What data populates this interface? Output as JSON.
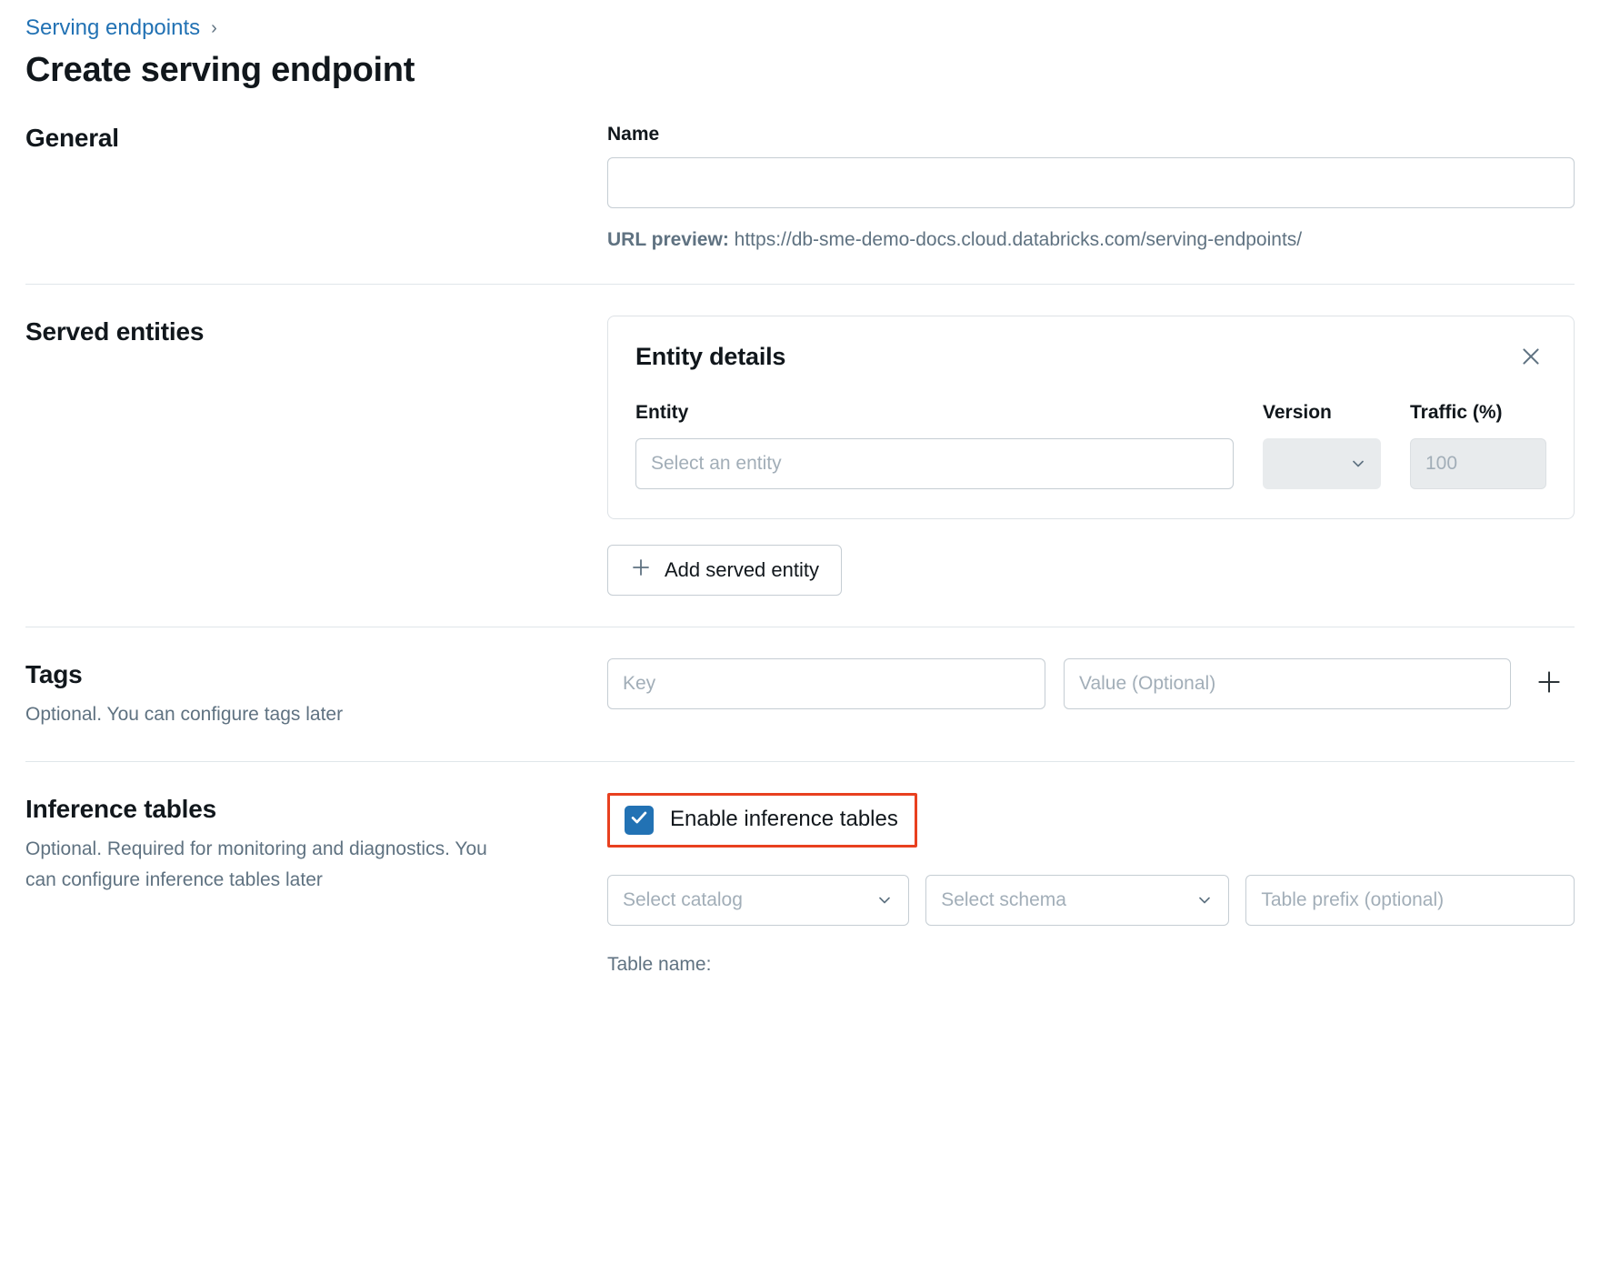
{
  "breadcrumb": {
    "link_label": "Serving endpoints",
    "separator": "›"
  },
  "page_title": "Create serving endpoint",
  "general": {
    "heading": "General",
    "name_label": "Name",
    "name_value": "",
    "name_placeholder": "",
    "url_preview_label": "URL preview:",
    "url_preview_value": "https://db-sme-demo-docs.cloud.databricks.com/serving-endpoints/"
  },
  "served_entities": {
    "heading": "Served entities",
    "card": {
      "title": "Entity details",
      "close_icon": "close-icon",
      "columns": {
        "entity": "Entity",
        "version": "Version",
        "traffic": "Traffic (%)"
      },
      "entity_placeholder": "Select an entity",
      "version_value": "",
      "version_disabled": true,
      "traffic_value": "100",
      "traffic_disabled": true
    },
    "add_button_label": "Add served entity",
    "add_button_icon": "plus-icon"
  },
  "tags": {
    "heading": "Tags",
    "description": "Optional. You can configure tags later",
    "key_placeholder": "Key",
    "key_value": "",
    "value_placeholder": "Value (Optional)",
    "value_value": "",
    "add_icon": "plus-icon"
  },
  "inference_tables": {
    "heading": "Inference tables",
    "description": "Optional. Required for monitoring and diagnostics. You can configure inference tables later",
    "checkbox_label": "Enable inference tables",
    "checkbox_checked": true,
    "catalog_placeholder": "Select catalog",
    "schema_placeholder": "Select schema",
    "prefix_placeholder": "Table prefix (optional)",
    "prefix_value": "",
    "table_name_label": "Table name:",
    "table_name_value": ""
  },
  "colors": {
    "link": "#2272B4",
    "checkbox_accent": "#2272B4",
    "highlight_border": "#E8401F",
    "text_primary": "#11171C",
    "text_muted": "#5F7281",
    "placeholder": "#A2AEB8",
    "border": "#C5CDD3",
    "divider": "#E0E6EA",
    "disabled_bg": "#E8EBED"
  }
}
